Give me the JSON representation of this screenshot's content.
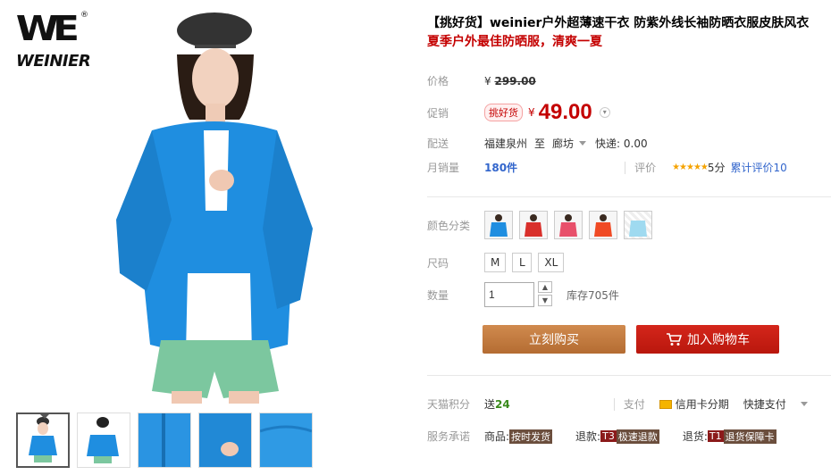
{
  "brand": {
    "logo_text": "WEINIER",
    "mark": "WE",
    "registered": "®"
  },
  "product": {
    "title": "【挑好货】weinier户外超薄速干衣 防紫外线长袖防晒衣服皮肤风衣",
    "subtitle": "夏季户外最佳防晒服，清爽一夏"
  },
  "price": {
    "label": "价格",
    "currency": "¥",
    "original": "299.00"
  },
  "promo": {
    "label": "促销",
    "tag": "挑好货",
    "currency": "¥",
    "value": "49.00"
  },
  "delivery": {
    "label": "配送",
    "from": "福建泉州",
    "to_word": "至",
    "to": "廊坊",
    "shipping": "快递: 0.00"
  },
  "sales": {
    "label": "月销量",
    "count": "180件",
    "review_label": "评价",
    "stars": "★★★★★",
    "score": "5分",
    "total": "累计评价10"
  },
  "color": {
    "label": "颜色分类",
    "options": [
      "blue",
      "red",
      "pink",
      "orange",
      "light-blue"
    ]
  },
  "size": {
    "label": "尺码",
    "options": [
      "M",
      "L",
      "XL"
    ]
  },
  "quantity": {
    "label": "数量",
    "value": "1",
    "stock": "库存705件"
  },
  "actions": {
    "buy": "立刻购买",
    "cart": "加入购物车"
  },
  "points": {
    "label": "天猫积分",
    "prefix": "送",
    "value": "24",
    "pay_label": "支付",
    "card": "信用卡分期",
    "quick": "快捷支付"
  },
  "service": {
    "label": "服务承诺",
    "item1_prefix": "商品:",
    "item1": "按时发货",
    "item2_prefix": "退款:",
    "item2_code": "T3",
    "item2": "极速退款",
    "item3_prefix": "退货:",
    "item3_code": "T1",
    "item3": "退货保障卡"
  },
  "colors": {
    "accent": "#c40000",
    "buy": "#c07a3f",
    "cart": "#c8200f",
    "jacket": "#1e88d8"
  }
}
